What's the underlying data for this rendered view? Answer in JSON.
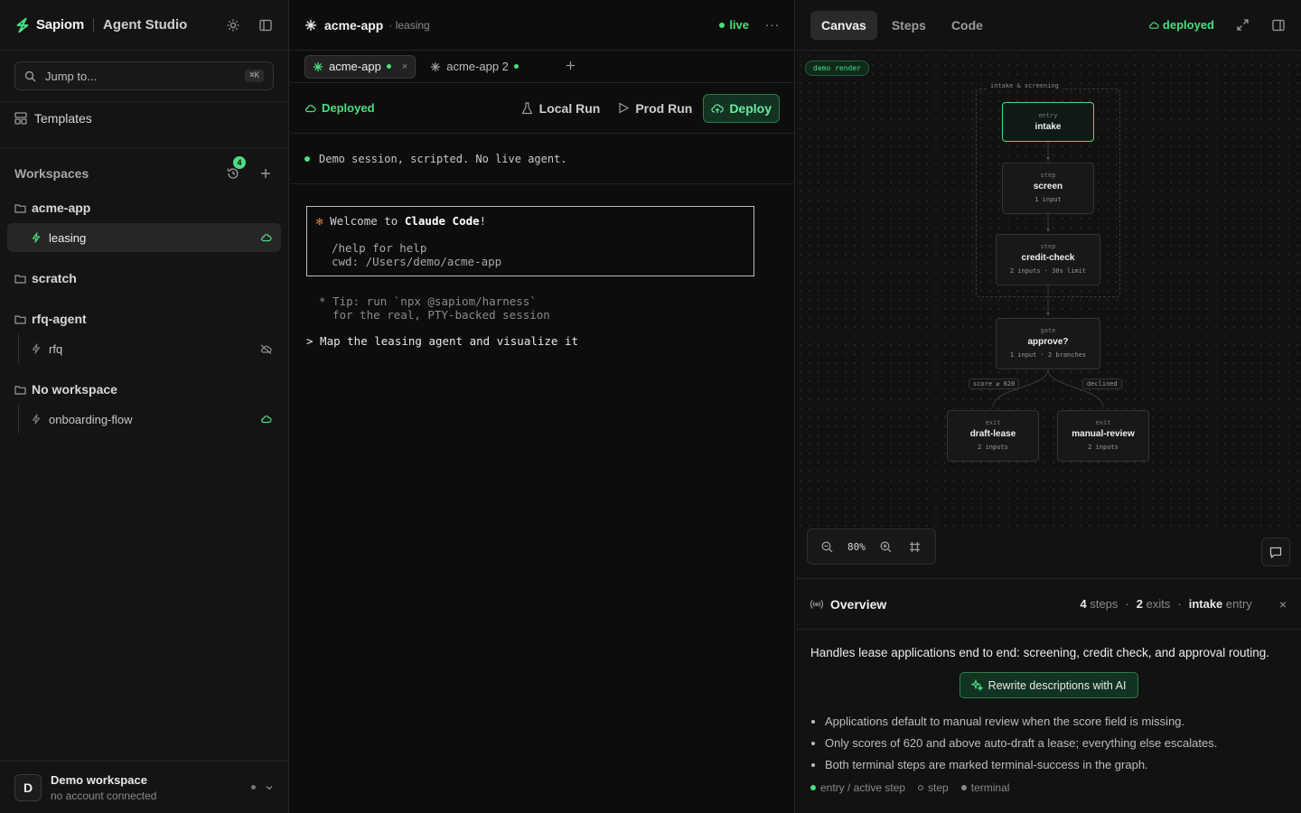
{
  "sidebar": {
    "brand": "Sapiom",
    "brand_sub": "Agent Studio",
    "search_placeholder": "Jump to...",
    "search_shortcut": "⌘K",
    "templates_label": "Templates",
    "workspaces_label": "Workspaces",
    "history_badge": "4",
    "groups": [
      {
        "name": "acme-app",
        "agents": [
          {
            "name": "leasing",
            "status": "deployed"
          }
        ]
      },
      {
        "name": "scratch",
        "agents": []
      },
      {
        "name": "rfq-agent",
        "agents": [
          {
            "name": "rfq",
            "status": "hidden"
          }
        ]
      },
      {
        "name": "No workspace",
        "agents": [
          {
            "name": "onboarding-flow",
            "status": "deployed"
          }
        ]
      }
    ],
    "account": {
      "initial": "D",
      "name": "Demo workspace",
      "sub": "no account connected"
    }
  },
  "session": {
    "title": "acme-app",
    "subtitle": "· leasing",
    "live_label": "live",
    "more_label": "···",
    "tabs": [
      {
        "label": "acme-app",
        "close": "×"
      },
      {
        "label": "acme-app 2"
      }
    ],
    "status_label": "Deployed",
    "actions": {
      "local_run": "Local Run",
      "prod_run": "Prod Run",
      "deploy": "Deploy"
    },
    "notice": "Demo session, scripted. No live agent.",
    "terminal": {
      "welcome_prefix": "Welcome to ",
      "welcome_bold": "Claude Code",
      "welcome_suffix": "!",
      "help_line": "/help for help",
      "cwd_line": "cwd: /Users/demo/acme-app",
      "tip_line1": "* Tip: run `npx @sapiom/harness`",
      "tip_line2": "for the real, PTY-backed session",
      "prompt": "> Map the leasing agent and visualize it"
    }
  },
  "panel": {
    "tabs": [
      "Canvas",
      "Steps",
      "Code"
    ],
    "deployed_label": "deployed",
    "canvas": {
      "demo_tag": "demo render",
      "group_label": "intake & screening",
      "nodes": [
        {
          "kind": "entry",
          "title": "intake",
          "meta": ""
        },
        {
          "kind": "step",
          "title": "screen",
          "meta": "1 input"
        },
        {
          "kind": "step",
          "title": "credit-check",
          "meta": "2 inputs · 30s limit"
        },
        {
          "kind": "gate",
          "title": "approve?",
          "meta": "1 input · 2 branches"
        },
        {
          "kind": "exit",
          "title": "draft-lease",
          "meta": "2 inputs"
        },
        {
          "kind": "exit",
          "title": "manual-review",
          "meta": "2 inputs"
        }
      ],
      "edge_labels": [
        "score ≥ 620",
        "declined"
      ],
      "zoom": "80%"
    },
    "overview": {
      "title": "Overview",
      "steps_count": "4",
      "steps_label": "steps",
      "exits_count": "2",
      "exits_label": "exits",
      "entry_name": "intake",
      "entry_label": "entry",
      "close": "×",
      "description": "Handles lease applications end to end: screening, credit check, and approval routing.",
      "rewrite_label": "Rewrite descriptions with AI",
      "notes": [
        "Applications default to manual review when the score field is missing.",
        "Only scores of 620 and above auto-draft a lease; everything else escalates.",
        "Both terminal steps are marked terminal-success in the graph."
      ],
      "legend": [
        {
          "label": "entry / active step",
          "color": "#4ade80"
        },
        {
          "label": "step",
          "color": "#777777"
        },
        {
          "label": "terminal",
          "color": "#888888"
        }
      ]
    }
  },
  "colors": {
    "accent": "#4ade80",
    "bg": "#0d0d0d",
    "panel": "#121212"
  }
}
